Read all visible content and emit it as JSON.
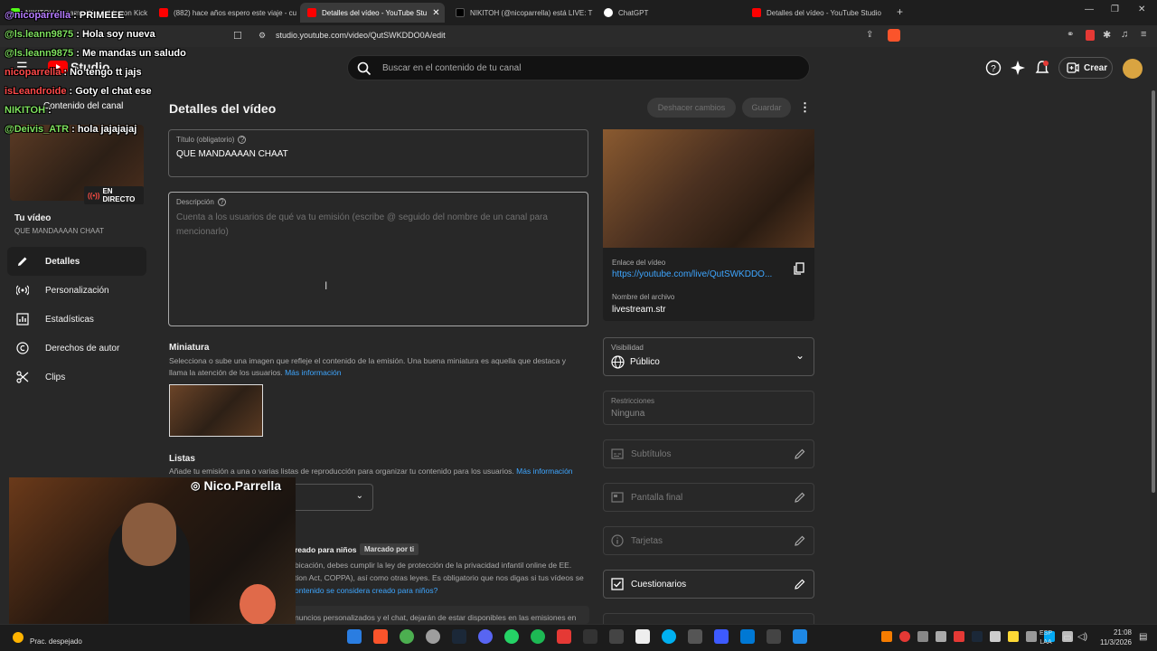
{
  "browser": {
    "tabs": [
      {
        "title": "NIKITOH Stream - Watch Live on Kick",
        "icon_color": "#53fc18",
        "active": false
      },
      {
        "title": "(882) hace años espero este viaje - cu",
        "icon_color": "#ff0000",
        "active": false
      },
      {
        "title": "Detalles del vídeo - YouTube Stu",
        "icon_color": "#ff0000",
        "active": true
      },
      {
        "title": "NIKITOH (@nicoparrella) está LIVE: T",
        "icon_color": "#000000",
        "active": false
      },
      {
        "title": "ChatGPT",
        "icon_color": "#ffffff",
        "active": false
      },
      {
        "title": "Detalles del vídeo - YouTube Studio",
        "icon_color": "#ff0000",
        "active": false
      }
    ],
    "url": "studio.youtube.com/video/QutSWKDDO0A/edit"
  },
  "header": {
    "logo_text": "Studio",
    "search_placeholder": "Buscar en el contenido de tu canal",
    "create_label": "Crear"
  },
  "sidebar": {
    "channel_content_label": "Contenido del canal",
    "live_badge": "EN DIRECTO",
    "your_video_label": "Tu vídeo",
    "video_title": "QUE MANDAAAAN CHAAT",
    "items": [
      {
        "label": "Detalles",
        "icon": "pencil-icon",
        "selected": true
      },
      {
        "label": "Personalización",
        "icon": "broadcast-icon",
        "selected": false
      },
      {
        "label": "Estadísticas",
        "icon": "analytics-icon",
        "selected": false
      },
      {
        "label": "Derechos de autor",
        "icon": "copyright-icon",
        "selected": false
      },
      {
        "label": "Clips",
        "icon": "scissors-icon",
        "selected": false
      }
    ]
  },
  "main": {
    "page_title": "Detalles del vídeo",
    "undo_label": "Deshacer cambios",
    "save_label": "Guardar",
    "title_field": {
      "label": "Título (obligatorio)",
      "value": "QUE MANDAAAAN CHAAT"
    },
    "description_field": {
      "label": "Descripción",
      "placeholder": "Cuenta a los usuarios de qué va tu emisión (escribe @ seguido del nombre de un canal para mencionarlo)"
    },
    "thumbnail": {
      "heading": "Miniatura",
      "text": "Selecciona o sube una imagen que refleje el contenido de la emisión. Una buena miniatura es aquella que destaca y llama la atención de los usuarios.",
      "link": "Más información"
    },
    "playlists": {
      "heading": "Listas",
      "text": "Añade tu emisión a una o varias listas de reproducción para organizar tu contenido para los usuarios.",
      "link": "Más información"
    },
    "audience": {
      "heading_tail": "reado para niños",
      "badge": "Marcado por ti",
      "line1": "bicación, debes cumplir la ley de protección de la privacidad infantil online de EE.",
      "line2": "tion Act, COPPA), así como otras leyes. Es obligatorio que nos digas si tus vídeos se",
      "link": "ontenido se considera creado para niños?",
      "line3": "nuncios personalizados y el chat, dejarán de estar disponibles en las emisiones en"
    }
  },
  "right_panel": {
    "video_link_label": "Enlace del vídeo",
    "video_link": "https://youtube.com/live/QutSWKDDO...",
    "file_name_label": "Nombre del archivo",
    "file_name": "livestream.str",
    "visibility_label": "Visibilidad",
    "visibility_value": "Público",
    "restrictions_label": "Restricciones",
    "restrictions_value": "Ninguna",
    "rows": [
      {
        "label": "Subtítulos",
        "icon": "subtitles-icon",
        "enabled": false
      },
      {
        "label": "Pantalla final",
        "icon": "end-screen-icon",
        "enabled": false
      },
      {
        "label": "Tarjetas",
        "icon": "info-icon",
        "enabled": false
      },
      {
        "label": "Cuestionarios",
        "icon": "checkbox-icon",
        "enabled": true
      }
    ]
  },
  "overlay": {
    "chat": [
      {
        "user": "@nicoparrella",
        "msg": ": PRIMEEE"
      },
      {
        "user": "@ls.leann9875",
        "msg": ": Hola soy nueva"
      },
      {
        "user": "@ls.leann9875",
        "msg": ": Me mandas un saludo"
      },
      {
        "user": "nicoparrella",
        "msg": ": No tengo tt jajs"
      },
      {
        "user": "isLeandroide",
        "msg": ": Goty el chat ese"
      },
      {
        "user": "NIKITOH",
        "msg": ":"
      },
      {
        "user": "@Deivis_ATR",
        "msg": ": hola jajajajaj"
      }
    ],
    "webcam_handle": "Nico.Parrella"
  },
  "taskbar": {
    "weather": "Prac. despejado",
    "lang_top": "ESP",
    "lang_bottom": "LAA",
    "time": "21:08",
    "date": "11/3/2026"
  }
}
